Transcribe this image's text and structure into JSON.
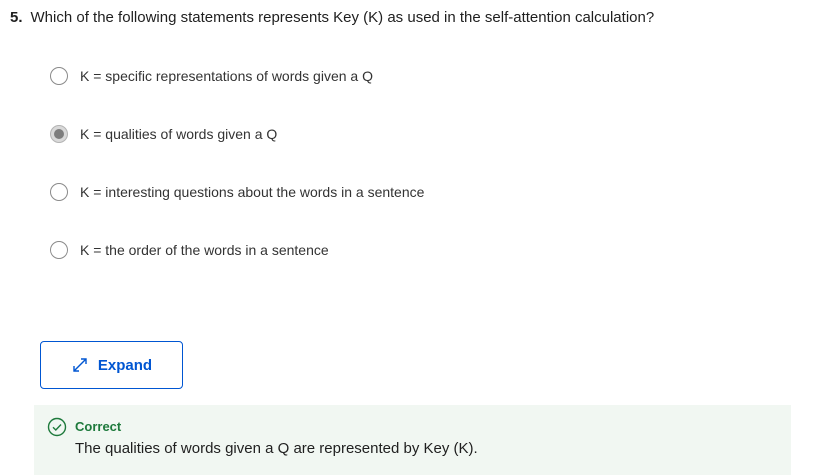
{
  "question": {
    "number": "5.",
    "text": "Which of the following statements represents Key (K) as used in the self-attention calculation?"
  },
  "options": [
    {
      "label": "K = specific representations of words given a Q",
      "selected": false
    },
    {
      "label": "K = qualities of words given a Q",
      "selected": true
    },
    {
      "label": "K = interesting questions about the words in a sentence",
      "selected": false
    },
    {
      "label": "K = the order of the words in a sentence",
      "selected": false
    }
  ],
  "expand": {
    "label": "Expand",
    "icon": "expand-arrows-icon"
  },
  "feedback": {
    "status": "Correct",
    "icon": "check-circle-icon",
    "explanation": "The qualities of words given a Q are represented by Key (K)."
  },
  "colors": {
    "accent": "#0056d2",
    "correct": "#1e7a3c",
    "feedback_bg": "#f1f7f2"
  }
}
